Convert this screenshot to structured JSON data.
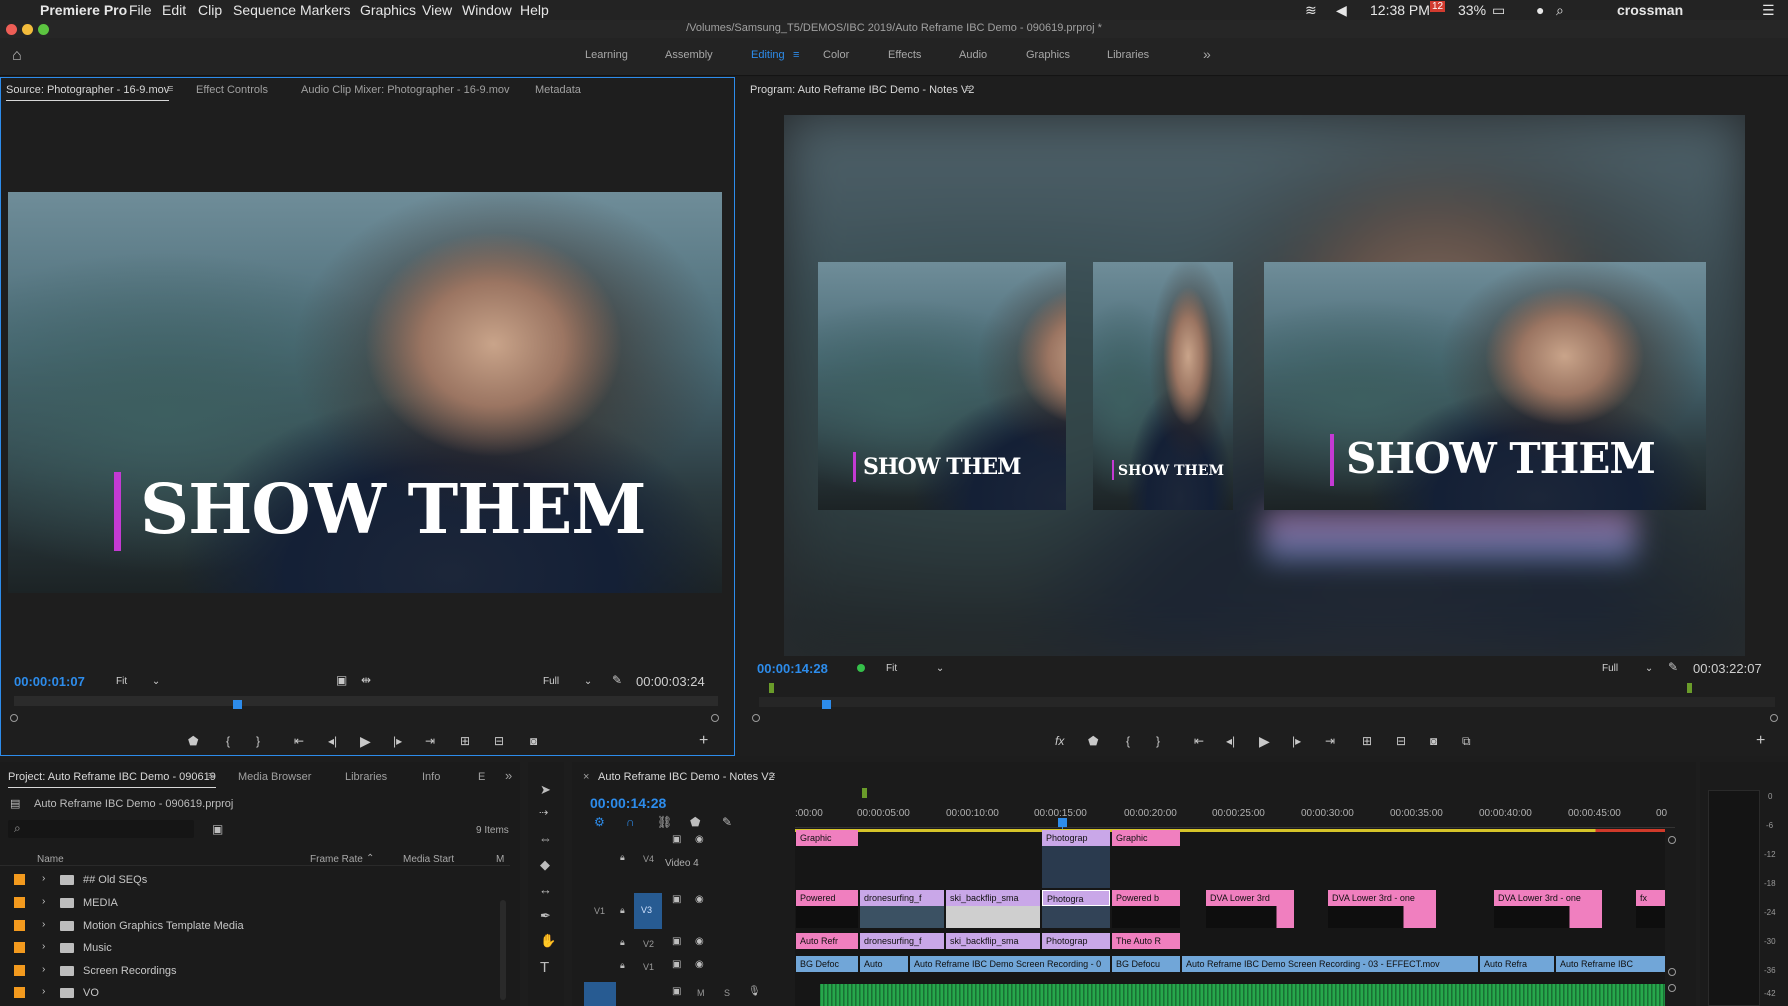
{
  "menubar": {
    "app_name": "Premiere Pro",
    "menus": [
      "File",
      "Edit",
      "Clip",
      "Sequence",
      "Markers",
      "Graphics",
      "View",
      "Window",
      "Help"
    ],
    "time": "12:38 PM",
    "battery": "33%",
    "date_badge": "12",
    "user": "crossman"
  },
  "window": {
    "title": "/Volumes/Samsung_T5/DEMOS/IBC 2019/Auto Reframe IBC Demo - 090619.prproj *"
  },
  "workspaces": {
    "tabs": [
      "Learning",
      "Assembly",
      "Editing",
      "Color",
      "Effects",
      "Audio",
      "Graphics",
      "Libraries"
    ],
    "active": "Editing",
    "more": "»"
  },
  "source_panel": {
    "tabs": [
      "Source: Photographer - 16-9.mov",
      "Effect Controls",
      "Audio Clip Mixer: Photographer - 16-9.mov",
      "Metadata"
    ],
    "overlay_text": "SHOW THEM",
    "timecode": "00:00:01:07",
    "zoom": "Fit",
    "quality": "Full",
    "duration": "00:00:03:24"
  },
  "program_panel": {
    "title": "Program: Auto Reframe IBC Demo - Notes V2",
    "overlay_text": "SHOW THEM",
    "timecode": "00:00:14:28",
    "zoom": "Fit",
    "quality": "Full",
    "duration": "00:03:22:07"
  },
  "project_panel": {
    "tabs": [
      "Project: Auto Reframe IBC Demo - 090619",
      "Media Browser",
      "Libraries",
      "Info",
      "E"
    ],
    "project_file": "Auto Reframe IBC Demo - 090619.prproj",
    "item_count": "9 Items",
    "columns": [
      "Name",
      "Frame Rate",
      "Media Start",
      "M"
    ],
    "rows": [
      "## Old SEQs",
      "MEDIA",
      "Motion Graphics Template Media",
      "Music",
      "Screen Recordings",
      "VO"
    ]
  },
  "timeline": {
    "title": "Auto Reframe IBC Demo - Notes V2",
    "timecode": "00:00:14:28",
    "ruler": [
      ":00:00",
      "00:00:05:00",
      "00:00:10:00",
      "00:00:15:00",
      "00:00:20:00",
      "00:00:25:00",
      "00:00:30:00",
      "00:00:35:00",
      "00:00:40:00",
      "00:00:45:00",
      "00"
    ],
    "tracks": {
      "v4": "V4",
      "v4_name": "Video 4",
      "v3": "V3",
      "v1_src": "V1",
      "v2": "V2",
      "v1": "V1",
      "m": "M",
      "s": "S"
    },
    "clips_v4": [
      "Graphic",
      "Photograp",
      "Graphic"
    ],
    "clips_v3": [
      "Powered",
      "dronesurfing_f",
      "ski_backflip_sma",
      "Photogra",
      "Powered b",
      "DVA Lower 3rd",
      "DVA Lower 3rd - one",
      "DVA Lower 3rd - one"
    ],
    "clips_v2": [
      "Auto Refr",
      "dronesurfing_f",
      "ski_backflip_sma",
      "Photograp",
      "The Auto R"
    ],
    "clips_v1": [
      "BG Defoc",
      "Auto",
      "Auto Reframe IBC Demo Screen Recording - 0",
      "BG Defocu",
      "Auto Reframe IBC Demo Screen Recording - 03 - EFFECT.mov",
      "Auto Refra",
      "Auto Reframe IBC"
    ]
  },
  "meter": {
    "labels": [
      "0",
      "-6",
      "-12",
      "-18",
      "-24",
      "-30",
      "-36",
      "-42"
    ]
  }
}
